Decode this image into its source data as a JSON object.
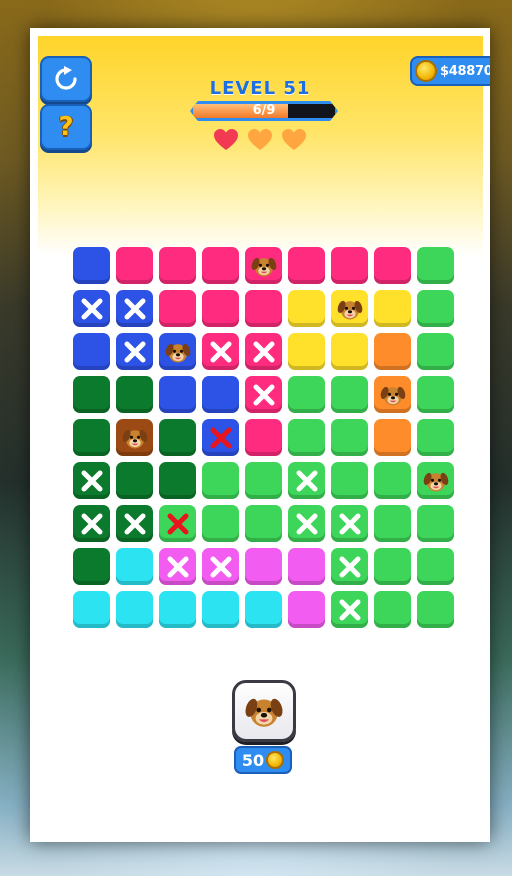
{
  "header": {
    "level_label": "LEVEL 51",
    "progress_text": "6/9",
    "progress_fraction": 0.667,
    "coins": "$48870",
    "hearts": [
      "full",
      "empty",
      "empty"
    ]
  },
  "buttons": {
    "restart_icon": "restart-icon",
    "help_icon": "question-icon",
    "help_label": "?"
  },
  "hint": {
    "price": "50",
    "icon": "dog-face-icon"
  },
  "colors": {
    "blue": "#2d52e6",
    "pink": "#ff2b7e",
    "green": "#3dd65a",
    "yellow": "#ffe02a",
    "orange": "#ff8c2a",
    "darkgreen": "#0c7a2c",
    "cyan": "#2ce3f2",
    "magenta": "#f25cf0",
    "brown": "#9a4a12"
  },
  "board": {
    "rows": [
      [
        {
          "c": "blue"
        },
        {
          "c": "pink"
        },
        {
          "c": "pink"
        },
        {
          "c": "pink"
        },
        {
          "c": "pink",
          "m": "dog"
        },
        {
          "c": "pink"
        },
        {
          "c": "pink"
        },
        {
          "c": "pink"
        },
        {
          "c": "green"
        }
      ],
      [
        {
          "c": "blue",
          "m": "x"
        },
        {
          "c": "blue",
          "m": "x"
        },
        {
          "c": "pink"
        },
        {
          "c": "pink"
        },
        {
          "c": "pink"
        },
        {
          "c": "yellow"
        },
        {
          "c": "yellow",
          "m": "dog"
        },
        {
          "c": "yellow"
        },
        {
          "c": "green"
        }
      ],
      [
        {
          "c": "blue"
        },
        {
          "c": "blue",
          "m": "x"
        },
        {
          "c": "blue",
          "m": "dog"
        },
        {
          "c": "pink",
          "m": "x"
        },
        {
          "c": "pink",
          "m": "x"
        },
        {
          "c": "yellow"
        },
        {
          "c": "yellow"
        },
        {
          "c": "orange"
        },
        {
          "c": "green"
        }
      ],
      [
        {
          "c": "darkgreen"
        },
        {
          "c": "darkgreen"
        },
        {
          "c": "blue"
        },
        {
          "c": "blue"
        },
        {
          "c": "pink",
          "m": "x"
        },
        {
          "c": "green"
        },
        {
          "c": "green"
        },
        {
          "c": "orange",
          "m": "dog"
        },
        {
          "c": "green"
        }
      ],
      [
        {
          "c": "darkgreen"
        },
        {
          "c": "brown",
          "m": "dog"
        },
        {
          "c": "darkgreen"
        },
        {
          "c": "blue",
          "m": "redx"
        },
        {
          "c": "pink"
        },
        {
          "c": "green"
        },
        {
          "c": "green"
        },
        {
          "c": "orange"
        },
        {
          "c": "green"
        }
      ],
      [
        {
          "c": "darkgreen",
          "m": "x"
        },
        {
          "c": "darkgreen"
        },
        {
          "c": "darkgreen"
        },
        {
          "c": "green"
        },
        {
          "c": "green"
        },
        {
          "c": "green",
          "m": "x"
        },
        {
          "c": "green"
        },
        {
          "c": "green"
        },
        {
          "c": "green",
          "m": "dog"
        }
      ],
      [
        {
          "c": "darkgreen",
          "m": "x"
        },
        {
          "c": "darkgreen",
          "m": "x"
        },
        {
          "c": "green",
          "m": "redx"
        },
        {
          "c": "green"
        },
        {
          "c": "green"
        },
        {
          "c": "green",
          "m": "x"
        },
        {
          "c": "green",
          "m": "x"
        },
        {
          "c": "green"
        },
        {
          "c": "green"
        }
      ],
      [
        {
          "c": "darkgreen"
        },
        {
          "c": "cyan"
        },
        {
          "c": "magenta",
          "m": "x"
        },
        {
          "c": "magenta",
          "m": "x"
        },
        {
          "c": "magenta"
        },
        {
          "c": "magenta"
        },
        {
          "c": "green",
          "m": "x"
        },
        {
          "c": "green"
        },
        {
          "c": "green"
        }
      ],
      [
        {
          "c": "cyan"
        },
        {
          "c": "cyan"
        },
        {
          "c": "cyan"
        },
        {
          "c": "cyan"
        },
        {
          "c": "cyan"
        },
        {
          "c": "magenta"
        },
        {
          "c": "green",
          "m": "x"
        },
        {
          "c": "green"
        },
        {
          "c": "green"
        }
      ]
    ]
  }
}
